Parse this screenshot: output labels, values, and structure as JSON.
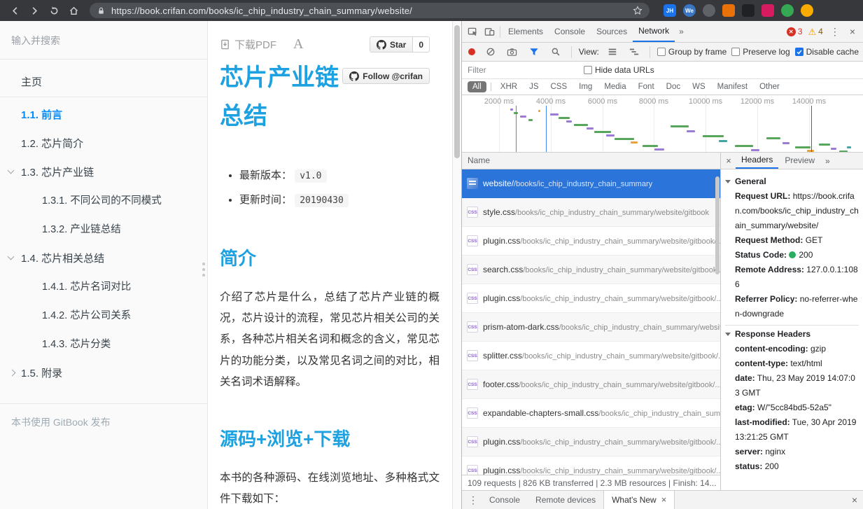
{
  "colors": {
    "accent": "#1da1e0",
    "sidebar_active": "#008cff",
    "devtools_accent": "#1a73e8",
    "row_selected": "#2b74d9",
    "status_green": "#27ae60",
    "record_red": "#d93025",
    "warning_yellow": "#f29900",
    "topbar_bg": "#36383b"
  },
  "browser": {
    "url": "https://book.crifan.com/books/ic_chip_industry_chain_summary/website/",
    "extensions": [
      {
        "name": "extension-icon-jh",
        "label": "JH",
        "color": "#1a73e8",
        "shape": "square"
      },
      {
        "name": "extension-icon-we",
        "label": "We",
        "color": "#3a76c4",
        "shape": "circle"
      },
      {
        "name": "extension-icon-gear",
        "label": "",
        "color": "#5f6368",
        "shape": "circle"
      },
      {
        "name": "extension-icon-orange",
        "label": "",
        "color": "#e8710a",
        "shape": "square"
      },
      {
        "name": "extension-icon-qr",
        "label": "",
        "color": "#202124",
        "shape": "square"
      },
      {
        "name": "extension-icon-pink",
        "label": "",
        "color": "#d81b60",
        "shape": "square"
      },
      {
        "name": "extension-icon-green",
        "label": "",
        "color": "#34a853",
        "shape": "circle"
      },
      {
        "name": "profile-avatar",
        "label": "",
        "color": "#f9ab00",
        "shape": "circle"
      }
    ]
  },
  "sidebar": {
    "search_placeholder": "输入并搜索",
    "items": [
      {
        "label": "主页"
      },
      {
        "label": "1.1. 前言"
      },
      {
        "label": "1.2. 芯片简介"
      },
      {
        "label": "1.3. 芯片产业链"
      },
      {
        "label": "1.3.1. 不同公司的不同模式"
      },
      {
        "label": "1.3.2. 产业链总结"
      },
      {
        "label": "1.4. 芯片相关总结"
      },
      {
        "label": "1.4.1. 芯片名词对比"
      },
      {
        "label": "1.4.2. 芯片公司关系"
      },
      {
        "label": "1.4.3. 芯片分类"
      },
      {
        "label": "1.5. 附录"
      }
    ],
    "footer": "本书使用 GitBook 发布"
  },
  "content": {
    "download_pdf": "下载PDF",
    "font_button": "A",
    "star_label": "Star",
    "star_count": "0",
    "follow_label": "Follow @crifan",
    "title": "芯片产业链总结",
    "meta": [
      {
        "label": "最新版本：",
        "value": "v1.0"
      },
      {
        "label": "更新时间：",
        "value": "20190430"
      }
    ],
    "sections": [
      {
        "heading": "简介",
        "paragraph": "介绍了芯片是什么，总结了芯片产业链的概况，芯片设计的流程，常见芯片相关公司的关系，各种芯片相关名词和概念的含义，常见芯片的功能分类，以及常见名词之间的对比，相关名词术语解释。"
      },
      {
        "heading": "源码+浏览+下载",
        "paragraph": "本书的各种源码、在线浏览地址、多种格式文件下载如下："
      }
    ]
  },
  "glyphs": {
    "close": "×",
    "kebab": "⋮",
    "more": "»",
    "error_x": "✕",
    "warning": "⚠"
  },
  "devtools": {
    "tabs": {
      "elements": "Elements",
      "console": "Console",
      "sources": "Sources",
      "network": "Network"
    },
    "badges": {
      "errors": "3",
      "warnings": "4"
    },
    "toolbar": {
      "view_label": "View:",
      "group_by_frame": "Group by frame",
      "preserve_log": "Preserve log",
      "disable_cache": "Disable cache"
    },
    "filter": {
      "placeholder": "Filter",
      "hide_data_urls": "Hide data URLs",
      "types": [
        "All",
        "XHR",
        "JS",
        "CSS",
        "Img",
        "Media",
        "Font",
        "Doc",
        "WS",
        "Manifest",
        "Other"
      ]
    },
    "overview": {
      "ticks": [
        "2000 ms",
        "4000 ms",
        "6000 ms",
        "8000 ms",
        "10000 ms",
        "12000 ms",
        "14000 ms"
      ],
      "colors": {
        "g": "#58a55c",
        "p": "#9b7bd4",
        "o": "#e8a33d",
        "t": "#42a5a0"
      },
      "bars": [
        [
          12,
          3,
          4,
          "p"
        ],
        [
          13,
          8,
          6,
          "g"
        ],
        [
          14.5,
          13,
          9,
          "p"
        ],
        [
          16.5,
          18,
          6,
          "g"
        ],
        [
          19,
          5,
          3,
          "o"
        ],
        [
          22,
          10,
          12,
          "p"
        ],
        [
          24,
          15,
          16,
          "g"
        ],
        [
          26,
          20,
          8,
          "p"
        ],
        [
          28,
          25,
          20,
          "g"
        ],
        [
          31,
          30,
          10,
          "p"
        ],
        [
          33,
          35,
          24,
          "g"
        ],
        [
          36,
          40,
          12,
          "p"
        ],
        [
          38,
          45,
          28,
          "g"
        ],
        [
          42,
          50,
          10,
          "o"
        ],
        [
          45,
          55,
          22,
          "g"
        ],
        [
          48,
          60,
          14,
          "p"
        ],
        [
          52,
          27,
          26,
          "g"
        ],
        [
          56,
          34,
          12,
          "p"
        ],
        [
          60,
          41,
          30,
          "g"
        ],
        [
          64,
          48,
          12,
          "t"
        ],
        [
          68,
          55,
          26,
          "g"
        ],
        [
          72,
          61,
          12,
          "p"
        ],
        [
          76,
          44,
          20,
          "g"
        ],
        [
          80,
          51,
          10,
          "p"
        ],
        [
          83,
          57,
          22,
          "g"
        ],
        [
          86,
          62,
          10,
          "o"
        ],
        [
          89,
          53,
          16,
          "g"
        ],
        [
          92,
          59,
          8,
          "p"
        ],
        [
          94,
          63,
          12,
          "g"
        ],
        [
          96,
          57,
          6,
          "t"
        ]
      ],
      "vlines": [
        [
          13.5,
          "#4285f4"
        ],
        [
          21,
          "#4285f4"
        ],
        [
          87,
          "#d93025"
        ]
      ]
    },
    "network": {
      "name_header": "Name",
      "requests": [
        {
          "name": "website/",
          "path": "/books/ic_chip_industry_chain_summary",
          "type": "doc"
        },
        {
          "name": "style.css",
          "path": "/books/ic_chip_industry_chain_summary/website/gitbook",
          "type": "css"
        },
        {
          "name": "plugin.css",
          "path": "/books/ic_chip_industry_chain_summary/website/gitbook/...",
          "type": "css"
        },
        {
          "name": "search.css",
          "path": "/books/ic_chip_industry_chain_summary/website/gitbook/...",
          "type": "css"
        },
        {
          "name": "plugin.css",
          "path": "/books/ic_chip_industry_chain_summary/website/gitbook/...",
          "type": "css"
        },
        {
          "name": "prism-atom-dark.css",
          "path": "/books/ic_chip_industry_chain_summary/website/gitbook/...",
          "type": "css"
        },
        {
          "name": "splitter.css",
          "path": "/books/ic_chip_industry_chain_summary/website/gitbook/...",
          "type": "css"
        },
        {
          "name": "footer.css",
          "path": "/books/ic_chip_industry_chain_summary/website/gitbook/...",
          "type": "css"
        },
        {
          "name": "expandable-chapters-small.css",
          "path": "/books/ic_chip_industry_chain_summary/website/gitbook/...",
          "type": "css"
        },
        {
          "name": "plugin.css",
          "path": "/books/ic_chip_industry_chain_summary/website/gitbook/...",
          "type": "css"
        },
        {
          "name": "plugin.css",
          "path": "/books/ic_chip_industry_chain_summary/website/gitbook/...",
          "type": "css"
        }
      ]
    },
    "headers_pane": {
      "tabs": [
        "Headers",
        "Preview"
      ],
      "general_title": "General",
      "general": [
        {
          "key": "Request URL:",
          "value": "https://book.crifan.com/books/ic_chip_industry_chain_summary/website/"
        },
        {
          "key": "Request Method:",
          "value": "GET"
        },
        {
          "key": "Status Code:",
          "value": "200"
        },
        {
          "key": "Remote Address:",
          "value": "127.0.0.1:1086"
        },
        {
          "key": "Referrer Policy:",
          "value": "no-referrer-when-downgrade"
        }
      ],
      "response_title": "Response Headers",
      "response": [
        {
          "key": "content-encoding:",
          "value": "gzip"
        },
        {
          "key": "content-type:",
          "value": "text/html"
        },
        {
          "key": "date:",
          "value": "Thu, 23 May 2019 14:07:03 GMT"
        },
        {
          "key": "etag:",
          "value": "W/\"5cc84bd5-52a5\""
        },
        {
          "key": "last-modified:",
          "value": "Tue, 30 Apr 2019 13:21:25 GMT"
        },
        {
          "key": "server:",
          "value": "nginx"
        },
        {
          "key": "status:",
          "value": "200"
        }
      ]
    },
    "status_bar": "109 requests | 826 KB transferred | 2.3 MB resources | Finish: 14...",
    "drawer": {
      "console": "Console",
      "remote_devices": "Remote devices",
      "whats_new": "What's New"
    }
  }
}
